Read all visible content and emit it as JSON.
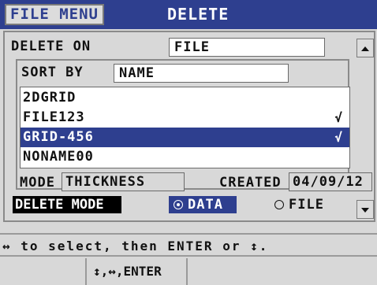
{
  "header": {
    "menu_tab": "FILE MENU",
    "title": "DELETE"
  },
  "delete_on": {
    "label": "DELETE ON",
    "value": "FILE"
  },
  "sort_by": {
    "label": "SORT BY",
    "value": "NAME"
  },
  "files": [
    {
      "name": "2DGRID",
      "check": ""
    },
    {
      "name": "FILE123",
      "check": "√"
    },
    {
      "name": "GRID-456",
      "check": "√"
    },
    {
      "name": "NONAME00",
      "check": ""
    }
  ],
  "selected_index": 2,
  "info": {
    "mode_label": "MODE",
    "mode_value": "THICKNESS",
    "created_label": "CREATED",
    "created_value": "04/09/12"
  },
  "delete_mode": {
    "label": "DELETE MODE",
    "options": [
      "DATA",
      "FILE"
    ],
    "selected": "DATA"
  },
  "help_text": "↔ to select, then ENTER or ↕.",
  "status_bar": {
    "left": "",
    "keys": "↕,↔,ENTER",
    "right": ""
  },
  "colors": {
    "accent": "#2e3f8f",
    "panel": "#d8d8d8"
  }
}
